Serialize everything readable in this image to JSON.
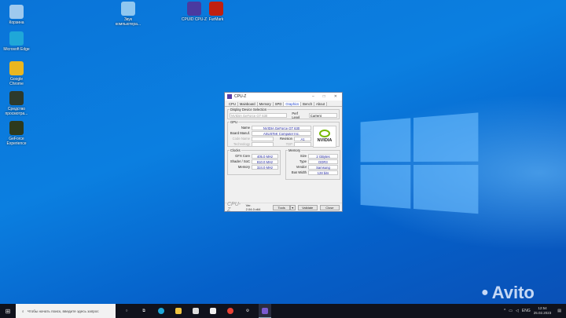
{
  "desktop": {
    "icons": [
      {
        "label": "Корзина",
        "color": "#9ec9ee"
      },
      {
        "label": "Microsoft Edge",
        "color": "#1fa7d8"
      },
      {
        "label": "Google Chrome",
        "color": "#e9b620"
      },
      {
        "label": "Средство просмотра...",
        "color": "#2d3a2b"
      },
      {
        "label": "GeForce Experience",
        "color": "#2d3a1d"
      },
      {
        "label": "Звук компьютера...",
        "color": "#8fc7f0"
      },
      {
        "label": "CPUID CPU-Z",
        "color": "#4a3aa0"
      },
      {
        "label": "FurMark",
        "color": "#c02010"
      }
    ]
  },
  "cpuz": {
    "title": "CPU-Z",
    "tabs": [
      "CPU",
      "Mainboard",
      "Memory",
      "SPD",
      "Graphics",
      "Bench",
      "About"
    ],
    "active_tab": "Graphics",
    "display_device_label": "Display Device Selection",
    "device": "NVIDIA GeForce GT 630",
    "perf_level_label": "Perf Level",
    "perf_level": "Current",
    "gpu_label": "GPU",
    "name_label": "Name",
    "name": "NVIDIA GeForce GT 630",
    "board_label": "Board Manuf.",
    "board": "ASUSTeK Computer Inc.",
    "code_label": "Code Name",
    "revision_label": "Revision",
    "revision": "A1",
    "tech_label": "Technology",
    "tdp_label": "TDP",
    "vendor_logo": "NVIDIA",
    "clocks_label": "Clocks",
    "gfx_label": "GFX Core",
    "gfx": "405.0 MHz",
    "shader_label": "Shader / SoC",
    "shader": "810.0 MHz",
    "mem_clock_label": "Memory",
    "mem_clock": "324.0 MHz",
    "memory_label": "Memory",
    "size_label": "Size",
    "size": "2 GBytes",
    "type_label": "Type",
    "type": "DDR3",
    "mvendor_label": "Vendor",
    "mvendor": "Samsung",
    "bus_label": "Bus Width",
    "bus": "128 bits",
    "brand": "CPU-Z",
    "version": "Ver. 2.04.0.x64",
    "tools": "Tools",
    "validate": "Validate",
    "close": "Close"
  },
  "taskbar": {
    "search_placeholder": "Чтобы начать поиск, введите здесь запрос",
    "lang": "ENG",
    "time": "12:54",
    "date": "25.02.2023"
  },
  "watermark": "Avito"
}
